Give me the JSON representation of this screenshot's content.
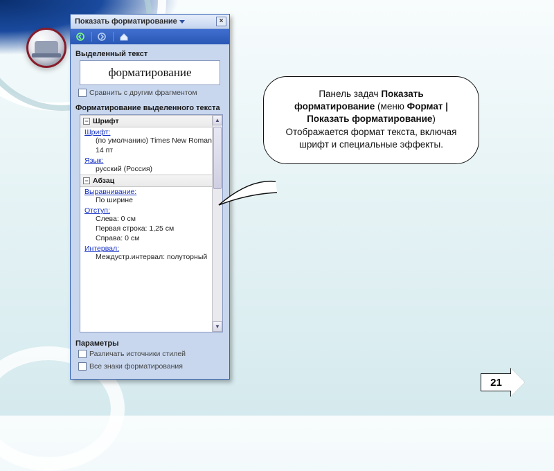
{
  "titlebar": {
    "title": "Показать форматирование",
    "close_char": "×"
  },
  "sections": {
    "selected_text": "Выделенный текст",
    "sample": "форматирование",
    "compare": "Сравнить с другим фрагментом",
    "formatting_of": "Форматирование выделенного текста",
    "options": "Параметры",
    "opt_sources": "Различать источники стилей",
    "opt_marks": "Все знаки форматирования"
  },
  "groups": {
    "font": {
      "head": "Шрифт",
      "font_link": "Шрифт:",
      "font_val1": "(по умолчанию) Times New Roman",
      "font_val2": "14 пт",
      "lang_link": "Язык:",
      "lang_val": "русский (Россия)"
    },
    "para": {
      "head": "Абзац",
      "align_link": "Выравнивание:",
      "align_val": "По ширине",
      "indent_link": "Отступ:",
      "indent_l": "Слева:  0 см",
      "indent_f": "Первая строка:  1,25 см",
      "indent_r": "Справа:  0 см",
      "spacing_link": "Интервал:",
      "spacing_val": "Междустр.интервал:  полуторный"
    }
  },
  "callout": {
    "t1": "Панель задач ",
    "b1": "Показать форматирование",
    "t2": " (меню ",
    "b2": "Формат | Показать форматирование",
    "t3": ") Отображается формат текста, включая шрифт и специальные эффекты."
  },
  "page_number": "21"
}
